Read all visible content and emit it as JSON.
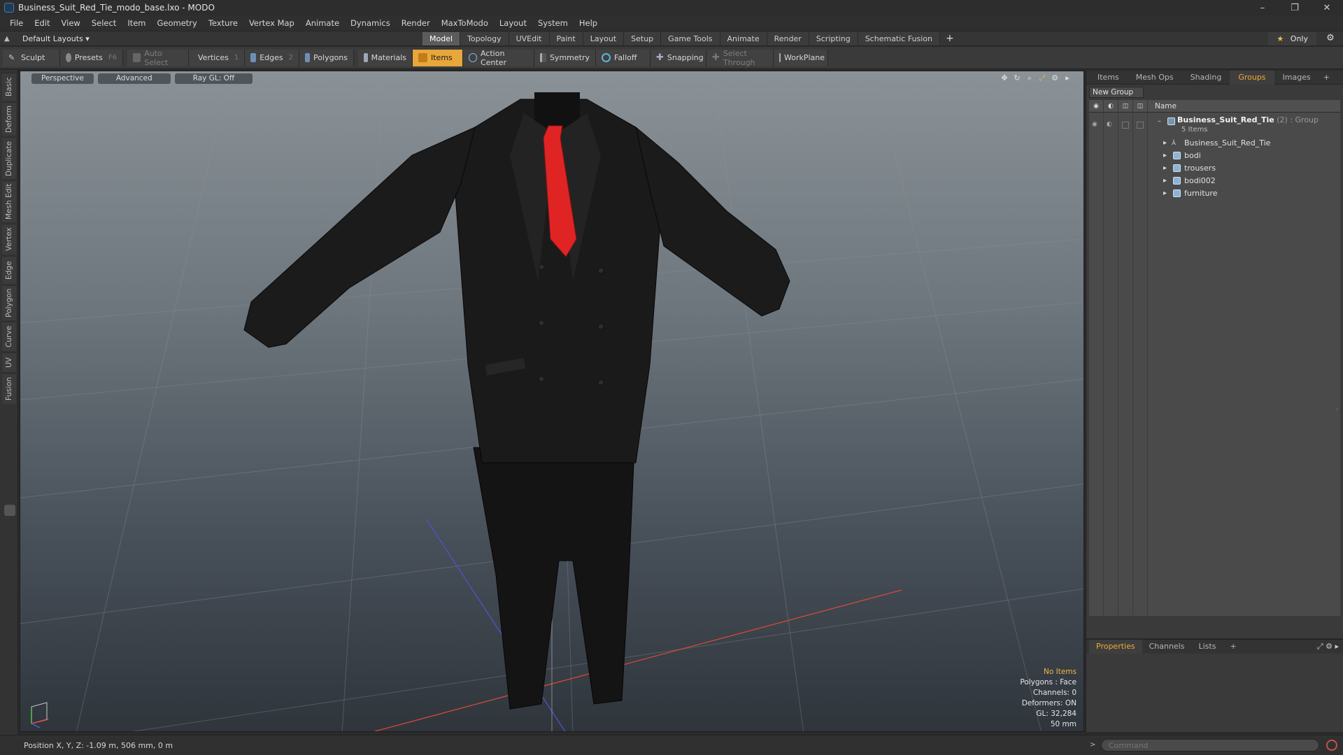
{
  "window": {
    "title": "Business_Suit_Red_Tie_modo_base.lxo - MODO",
    "controls": [
      "–",
      "❐",
      "✕"
    ]
  },
  "menu": [
    "File",
    "Edit",
    "View",
    "Select",
    "Item",
    "Geometry",
    "Texture",
    "Vertex Map",
    "Animate",
    "Dynamics",
    "Render",
    "MaxToModo",
    "Layout",
    "System",
    "Help"
  ],
  "layouts": {
    "selector": "Default Layouts ▾",
    "tabs": [
      "Model",
      "Topology",
      "UVEdit",
      "Paint",
      "Layout",
      "Setup",
      "Game Tools",
      "Animate",
      "Render",
      "Scripting",
      "Schematic Fusion"
    ],
    "active_tab": "Model",
    "add": "+",
    "only_label": "Only",
    "only_star": "★"
  },
  "toolbar": {
    "sculpt": "Sculpt",
    "presets": "Presets",
    "presets_key": "F6",
    "auto_select": "Auto Select",
    "vertices": "Vertices",
    "vertices_key": "1",
    "edges": "Edges",
    "edges_key": "2",
    "polygons": "Polygons",
    "materials": "Materials",
    "items": "Items",
    "action_center": "Action Center",
    "symmetry": "Symmetry",
    "falloff": "Falloff",
    "snapping": "Snapping",
    "select_through": "Select Through",
    "workplane": "WorkPlane"
  },
  "left_tabs": [
    "Basic",
    "Deform",
    "Duplicate",
    "Mesh Edit",
    "Vertex",
    "Edge",
    "Polygon",
    "Curve",
    "UV",
    "Fusion"
  ],
  "viewport": {
    "view": "Perspective",
    "advanced": "Advanced",
    "raygl": "Ray GL: Off",
    "info": {
      "items": "No Items",
      "polygons": "Polygons : Face",
      "channels": "Channels: 0",
      "deformers": "Deformers: ON",
      "gl": "GL: 32,284",
      "scale": "50 mm"
    }
  },
  "groups_panel": {
    "tabs": [
      "Items",
      "Mesh Ops",
      "Shading",
      "Groups",
      "Images"
    ],
    "active_tab": "Groups",
    "new_group": "New Group",
    "name_header": "Name",
    "group": {
      "name": "Business_Suit_Red_Tie",
      "tag": "(2) : Group",
      "count": "5 Items"
    },
    "children": [
      "Business_Suit_Red_Tie",
      "bodi",
      "trousers",
      "bodi002",
      "furniture"
    ]
  },
  "properties_panel": {
    "tabs": [
      "Properties",
      "Channels",
      "Lists"
    ],
    "active_tab": "Properties"
  },
  "status": {
    "position": "Position X, Y, Z:  -1.09 m, 506 mm, 0 m"
  },
  "command": {
    "placeholder": "Command"
  },
  "colors": {
    "accent": "#f0a937",
    "suit": "#1c1c1c",
    "tie": "#e02424"
  }
}
